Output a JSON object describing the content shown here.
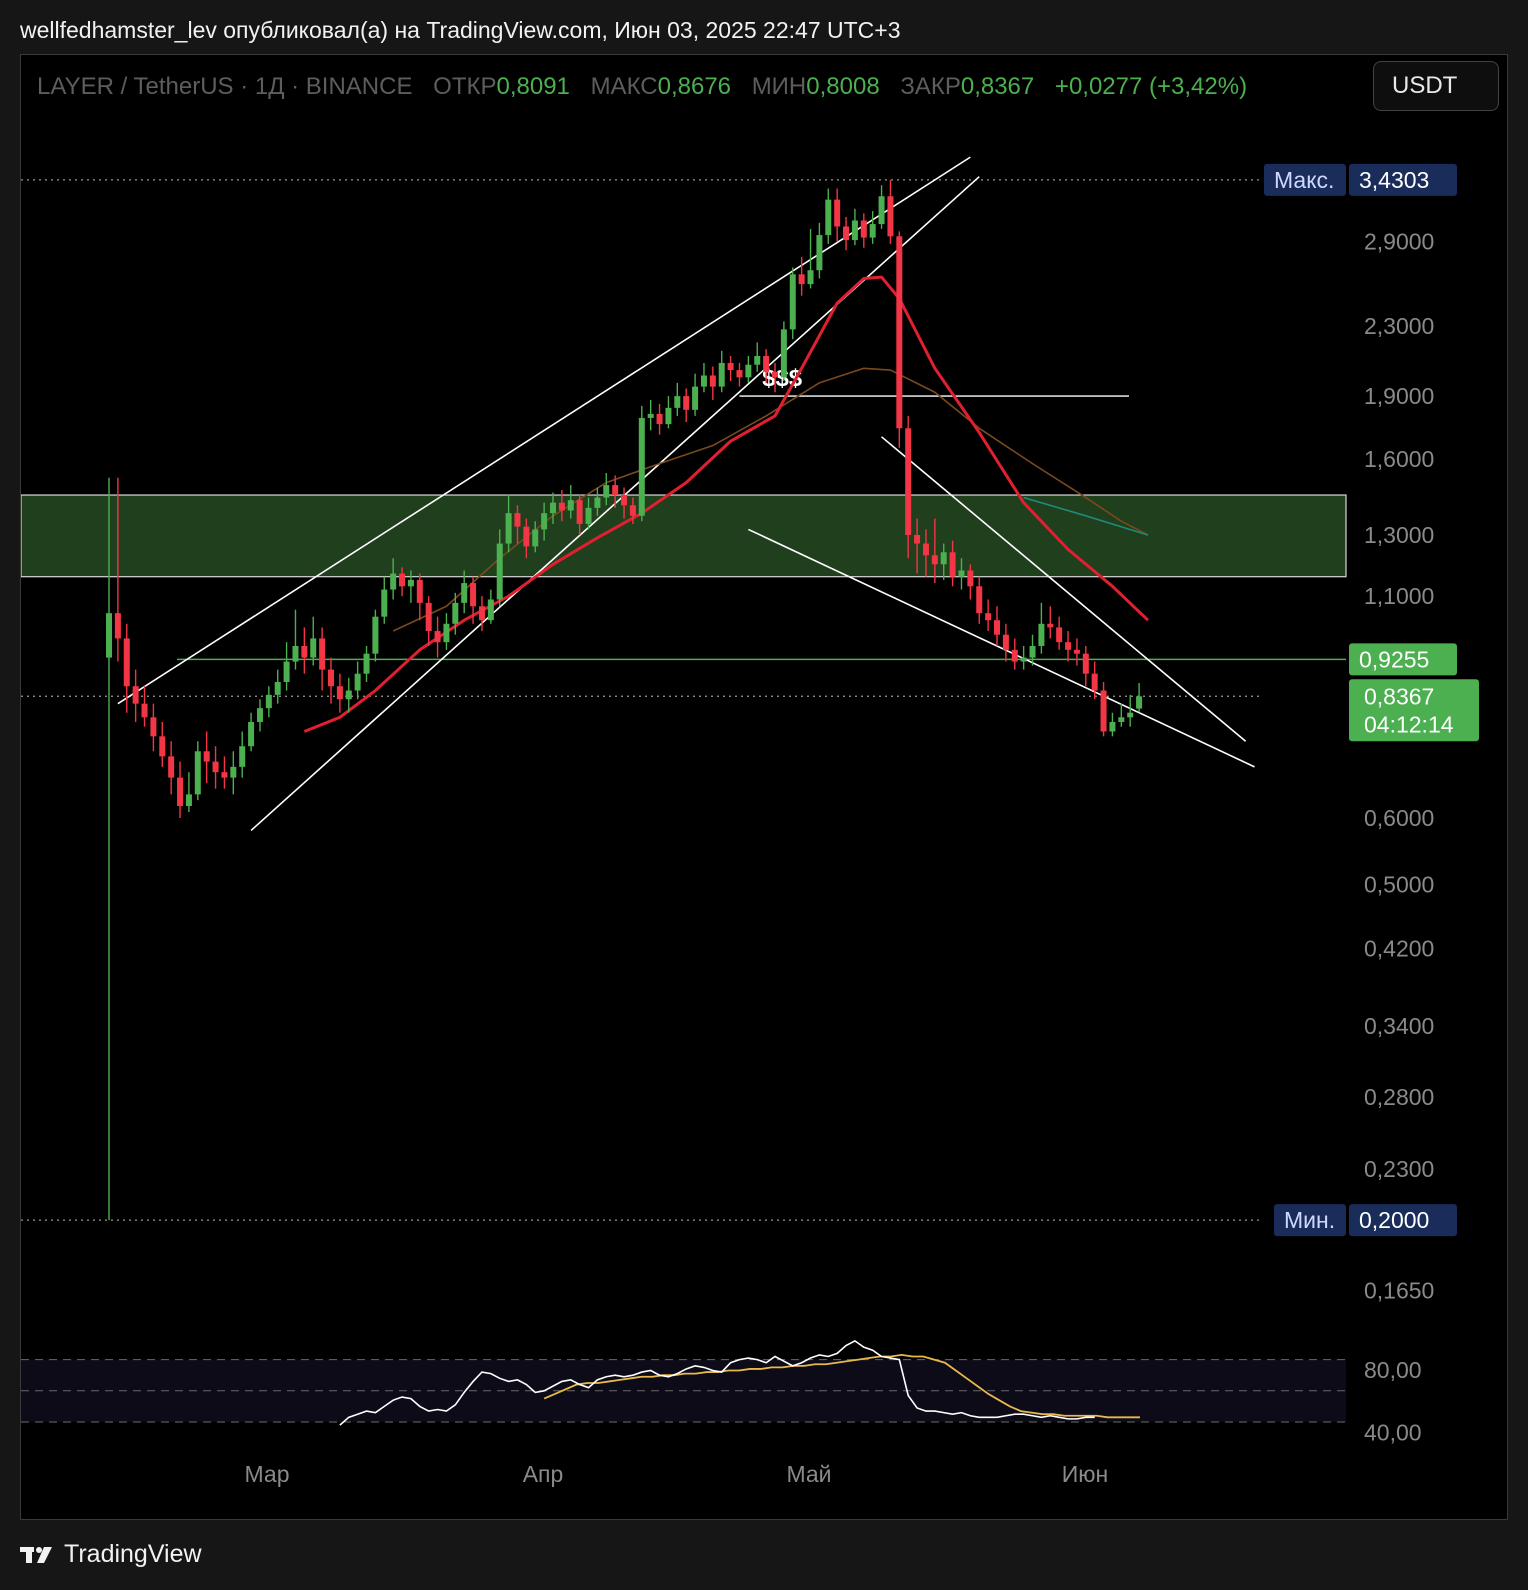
{
  "header": {
    "publisher_line": "wellfedhamster_lev опубликовал(а) на TradingView.com, Июн 03, 2025 22:47 UTC+3"
  },
  "legend": {
    "symbol": "LAYER / TetherUS · 1Д · BINANCE",
    "open_label": "ОТКР",
    "open": "0,8091",
    "high_label": "МАКС",
    "high": "0,8676",
    "low_label": "МИН",
    "low": "0,8008",
    "close_label": "ЗАКР",
    "close": "0,8367",
    "change": "+0,0277 (+3,42%)"
  },
  "currency_button": "USDT",
  "footer": {
    "brand": "TradingView"
  },
  "colors": {
    "up": "#4caf50",
    "down": "#f23645",
    "ema_fast": "#e02030",
    "ema_slow": "#7a4a1e",
    "rsi": "#ffffff",
    "rsi_ma": "#e8b94a",
    "zone": "#1f3f1d",
    "badge_blue": "#1a2c5a",
    "badge_green": "#4caf50"
  },
  "chart_data": {
    "type": "candlestick",
    "scale": "log",
    "x_labels": [
      "Мар",
      "Апр",
      "Май",
      "Июн"
    ],
    "y_ticks": [
      "2,9000",
      "2,3000",
      "1,9000",
      "1,6000",
      "1,3000",
      "1,1000",
      "0,6000",
      "0,5000",
      "0,4200",
      "0,3400",
      "0,2800",
      "0,2300",
      "0,1650"
    ],
    "y_tick_values": [
      2.9,
      2.3,
      1.9,
      1.6,
      1.3,
      1.1,
      0.6,
      0.5,
      0.42,
      0.34,
      0.28,
      0.23,
      0.165
    ],
    "max_label": "Макс.",
    "max_value": "3,4303",
    "min_label": "Мин.",
    "min_value": "0,2000",
    "level_value": "0,9255",
    "last_price": "0,8367",
    "countdown": "04:12:14",
    "annotation": "$$$",
    "support_zone": [
      1.16,
      1.45
    ],
    "resistance_line": 1.9,
    "candles": [
      [
        0.93,
        1.05,
        1.52,
        0.2
      ],
      [
        1.05,
        0.98,
        1.52,
        0.92
      ],
      [
        0.98,
        0.86,
        1.02,
        0.8
      ],
      [
        0.86,
        0.82,
        0.9,
        0.78
      ],
      [
        0.82,
        0.79,
        0.86,
        0.77
      ],
      [
        0.79,
        0.75,
        0.82,
        0.72
      ],
      [
        0.75,
        0.71,
        0.78,
        0.69
      ],
      [
        0.71,
        0.67,
        0.74,
        0.64
      ],
      [
        0.67,
        0.62,
        0.7,
        0.6
      ],
      [
        0.62,
        0.64,
        0.68,
        0.61
      ],
      [
        0.64,
        0.72,
        0.74,
        0.63
      ],
      [
        0.72,
        0.7,
        0.76,
        0.66
      ],
      [
        0.7,
        0.68,
        0.73,
        0.65
      ],
      [
        0.68,
        0.67,
        0.71,
        0.65
      ],
      [
        0.67,
        0.69,
        0.72,
        0.64
      ],
      [
        0.69,
        0.73,
        0.76,
        0.67
      ],
      [
        0.73,
        0.78,
        0.8,
        0.72
      ],
      [
        0.78,
        0.81,
        0.83,
        0.76
      ],
      [
        0.81,
        0.84,
        0.86,
        0.79
      ],
      [
        0.84,
        0.87,
        0.9,
        0.82
      ],
      [
        0.87,
        0.92,
        0.97,
        0.85
      ],
      [
        0.92,
        0.96,
        1.06,
        0.9
      ],
      [
        0.96,
        0.93,
        1.01,
        0.89
      ],
      [
        0.93,
        0.98,
        1.04,
        0.91
      ],
      [
        0.98,
        0.9,
        1.01,
        0.85
      ],
      [
        0.9,
        0.86,
        0.93,
        0.82
      ],
      [
        0.86,
        0.83,
        0.89,
        0.8
      ],
      [
        0.83,
        0.85,
        0.88,
        0.8
      ],
      [
        0.85,
        0.89,
        0.92,
        0.83
      ],
      [
        0.89,
        0.94,
        0.96,
        0.87
      ],
      [
        0.94,
        1.04,
        1.06,
        0.92
      ],
      [
        1.04,
        1.12,
        1.16,
        1.02
      ],
      [
        1.12,
        1.17,
        1.22,
        1.09
      ],
      [
        1.17,
        1.13,
        1.19,
        1.1
      ],
      [
        1.13,
        1.15,
        1.18,
        1.08
      ],
      [
        1.15,
        1.08,
        1.17,
        1.03
      ],
      [
        1.08,
        1.0,
        1.1,
        0.96
      ],
      [
        1.0,
        0.97,
        1.04,
        0.93
      ],
      [
        0.97,
        1.02,
        1.05,
        0.95
      ],
      [
        1.02,
        1.08,
        1.11,
        0.99
      ],
      [
        1.08,
        1.14,
        1.18,
        1.05
      ],
      [
        1.14,
        1.07,
        1.16,
        1.02
      ],
      [
        1.07,
        1.03,
        1.1,
        1.0
      ],
      [
        1.03,
        1.09,
        1.12,
        1.02
      ],
      [
        1.09,
        1.27,
        1.32,
        1.07
      ],
      [
        1.27,
        1.38,
        1.45,
        1.24
      ],
      [
        1.38,
        1.33,
        1.41,
        1.27
      ],
      [
        1.33,
        1.26,
        1.36,
        1.22
      ],
      [
        1.26,
        1.32,
        1.35,
        1.24
      ],
      [
        1.32,
        1.38,
        1.42,
        1.28
      ],
      [
        1.38,
        1.42,
        1.46,
        1.34
      ],
      [
        1.42,
        1.39,
        1.47,
        1.35
      ],
      [
        1.39,
        1.43,
        1.49,
        1.36
      ],
      [
        1.43,
        1.34,
        1.45,
        1.3
      ],
      [
        1.34,
        1.4,
        1.44,
        1.32
      ],
      [
        1.4,
        1.44,
        1.48,
        1.37
      ],
      [
        1.44,
        1.49,
        1.54,
        1.41
      ],
      [
        1.49,
        1.45,
        1.53,
        1.4
      ],
      [
        1.45,
        1.41,
        1.48,
        1.36
      ],
      [
        1.41,
        1.37,
        1.44,
        1.34
      ],
      [
        1.37,
        1.79,
        1.85,
        1.35
      ],
      [
        1.79,
        1.81,
        1.88,
        1.73
      ],
      [
        1.81,
        1.76,
        1.86,
        1.71
      ],
      [
        1.76,
        1.84,
        1.9,
        1.74
      ],
      [
        1.84,
        1.9,
        1.97,
        1.8
      ],
      [
        1.9,
        1.83,
        1.94,
        1.77
      ],
      [
        1.83,
        1.95,
        2.02,
        1.8
      ],
      [
        1.95,
        2.01,
        2.08,
        1.92
      ],
      [
        2.01,
        1.95,
        2.06,
        1.88
      ],
      [
        1.95,
        2.08,
        2.15,
        1.92
      ],
      [
        2.08,
        2.04,
        2.12,
        1.98
      ],
      [
        2.04,
        2.0,
        2.08,
        1.95
      ],
      [
        2.0,
        2.07,
        2.12,
        1.97
      ],
      [
        2.07,
        2.12,
        2.2,
        2.03
      ],
      [
        2.12,
        2.03,
        2.16,
        1.97
      ],
      [
        2.03,
        2.0,
        2.08,
        1.92
      ],
      [
        2.0,
        2.28,
        2.33,
        1.98
      ],
      [
        2.28,
        2.65,
        2.7,
        2.22
      ],
      [
        2.65,
        2.58,
        2.78,
        2.5
      ],
      [
        2.58,
        2.68,
        3.0,
        2.55
      ],
      [
        2.68,
        2.95,
        3.05,
        2.62
      ],
      [
        2.95,
        3.25,
        3.35,
        2.88
      ],
      [
        3.25,
        3.02,
        3.35,
        2.9
      ],
      [
        3.02,
        2.91,
        3.1,
        2.83
      ],
      [
        2.91,
        3.07,
        3.17,
        2.87
      ],
      [
        3.07,
        2.93,
        3.13,
        2.85
      ],
      [
        2.93,
        3.04,
        3.15,
        2.88
      ],
      [
        3.04,
        3.28,
        3.38,
        3.0
      ],
      [
        3.28,
        2.94,
        3.43,
        2.88
      ],
      [
        2.94,
        1.74,
        2.98,
        1.65
      ],
      [
        1.74,
        1.3,
        1.8,
        1.22
      ],
      [
        1.3,
        1.27,
        1.36,
        1.17
      ],
      [
        1.27,
        1.23,
        1.32,
        1.16
      ],
      [
        1.23,
        1.2,
        1.36,
        1.14
      ],
      [
        1.2,
        1.24,
        1.27,
        1.15
      ],
      [
        1.24,
        1.16,
        1.28,
        1.13
      ],
      [
        1.16,
        1.18,
        1.22,
        1.12
      ],
      [
        1.18,
        1.13,
        1.2,
        1.09
      ],
      [
        1.13,
        1.05,
        1.16,
        1.02
      ],
      [
        1.05,
        1.03,
        1.09,
        1.0
      ],
      [
        1.03,
        0.99,
        1.07,
        0.96
      ],
      [
        0.99,
        0.95,
        1.02,
        0.92
      ],
      [
        0.95,
        0.92,
        0.98,
        0.9
      ],
      [
        0.92,
        0.93,
        0.96,
        0.9
      ],
      [
        0.93,
        0.96,
        0.99,
        0.91
      ],
      [
        0.96,
        1.02,
        1.08,
        0.94
      ],
      [
        1.02,
        1.01,
        1.07,
        0.98
      ],
      [
        1.01,
        0.97,
        1.04,
        0.95
      ],
      [
        0.97,
        0.95,
        1.0,
        0.92
      ],
      [
        0.95,
        0.94,
        0.98,
        0.91
      ],
      [
        0.94,
        0.89,
        0.96,
        0.86
      ],
      [
        0.89,
        0.85,
        0.92,
        0.83
      ],
      [
        0.85,
        0.76,
        0.87,
        0.75
      ],
      [
        0.76,
        0.78,
        0.8,
        0.75
      ],
      [
        0.78,
        0.79,
        0.82,
        0.77
      ],
      [
        0.79,
        0.8,
        0.84,
        0.77
      ],
      [
        0.809,
        0.8367,
        0.8676,
        0.8008
      ]
    ],
    "ema_fast": [
      [
        22,
        0.76
      ],
      [
        26,
        0.79
      ],
      [
        30,
        0.85
      ],
      [
        35,
        0.95
      ],
      [
        40,
        1.03
      ],
      [
        45,
        1.1
      ],
      [
        50,
        1.2
      ],
      [
        55,
        1.29
      ],
      [
        60,
        1.38
      ],
      [
        65,
        1.5
      ],
      [
        70,
        1.68
      ],
      [
        75,
        1.8
      ],
      [
        78,
        2.05
      ],
      [
        82,
        2.45
      ],
      [
        85,
        2.62
      ],
      [
        87,
        2.63
      ],
      [
        89,
        2.48
      ],
      [
        93,
        2.05
      ],
      [
        98,
        1.72
      ],
      [
        103,
        1.42
      ],
      [
        108,
        1.25
      ],
      [
        113,
        1.13
      ],
      [
        117,
        1.03
      ]
    ],
    "ema_slow": [
      [
        32,
        1.0
      ],
      [
        38,
        1.07
      ],
      [
        44,
        1.22
      ],
      [
        50,
        1.37
      ],
      [
        56,
        1.5
      ],
      [
        62,
        1.58
      ],
      [
        68,
        1.66
      ],
      [
        74,
        1.8
      ],
      [
        80,
        1.97
      ],
      [
        85,
        2.05
      ],
      [
        88,
        2.04
      ],
      [
        93,
        1.92
      ],
      [
        98,
        1.74
      ],
      [
        104,
        1.58
      ],
      [
        110,
        1.44
      ],
      [
        114,
        1.35
      ],
      [
        117,
        1.3
      ]
    ],
    "ema_long": [
      [
        103,
        1.44
      ],
      [
        110,
        1.37
      ],
      [
        117,
        1.3
      ]
    ],
    "rsi": {
      "ticks": [
        "80,00",
        "40,00"
      ],
      "band_upper": 70,
      "band_lower": 30,
      "rsi_values": [
        28,
        33,
        35,
        37,
        36,
        40,
        44,
        46,
        45,
        40,
        37,
        38,
        37,
        41,
        49,
        56,
        62,
        61,
        58,
        56,
        57,
        54,
        49,
        50,
        53,
        56,
        57,
        54,
        52,
        57,
        59,
        60,
        59,
        60,
        62,
        63,
        60,
        59,
        61,
        64,
        66,
        65,
        63,
        62,
        68,
        70,
        71,
        70,
        68,
        72,
        69,
        66,
        68,
        71,
        73,
        72,
        74,
        79,
        82,
        78,
        76,
        72,
        71,
        70,
        47,
        39,
        37,
        37,
        36,
        35,
        36,
        34,
        33,
        33,
        33,
        34,
        35,
        35,
        34,
        33,
        34,
        33,
        32,
        32,
        33,
        33
      ],
      "rsi_ma_values": [
        45,
        48,
        51,
        54,
        55,
        55,
        56,
        57,
        58,
        59,
        59,
        60,
        60,
        61,
        61,
        62,
        62,
        63,
        63,
        64,
        64,
        65,
        65,
        66,
        66,
        67,
        67,
        68,
        69,
        70,
        71,
        72,
        72,
        73,
        72,
        72,
        70,
        68,
        63,
        58,
        53,
        48,
        44,
        40,
        37,
        36,
        35,
        35,
        34,
        34,
        34,
        34,
        33,
        33,
        33,
        33
      ],
      "rsi_start_index": 26,
      "rsi_ma_start_index": 49
    }
  }
}
